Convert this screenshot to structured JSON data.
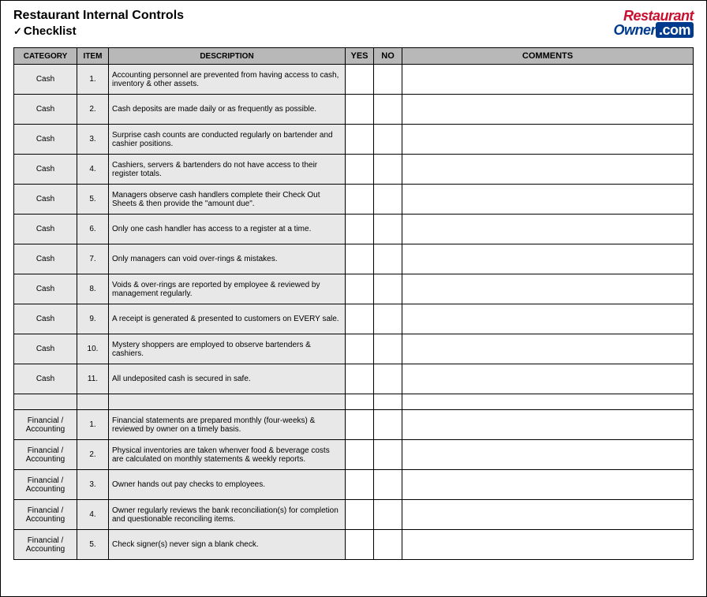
{
  "header": {
    "title": "Restaurant Internal Controls",
    "subtitle": "Checklist",
    "logo_top": "Restaurant",
    "logo_owner": "Owner",
    "logo_com": ".com"
  },
  "columns": {
    "category": "CATEGORY",
    "item": "ITEM",
    "description": "DESCRIPTION",
    "yes": "YES",
    "no": "NO",
    "comments": "COMMENTS"
  },
  "rows": [
    {
      "category": "Cash",
      "item": "1.",
      "description": "Accounting personnel are prevented from having access to cash, inventory & other assets."
    },
    {
      "category": "Cash",
      "item": "2.",
      "description": "Cash deposits are made daily or as frequently as possible."
    },
    {
      "category": "Cash",
      "item": "3.",
      "description": "Surprise cash counts are conducted regularly on bartender and cashier positions."
    },
    {
      "category": "Cash",
      "item": "4.",
      "description": "Cashiers, servers & bartenders do not have access to their register totals."
    },
    {
      "category": "Cash",
      "item": "5.",
      "description": "Managers observe cash handlers complete their Check Out Sheets & then provide the \"amount due\"."
    },
    {
      "category": "Cash",
      "item": "6.",
      "description": "Only one cash handler has access to a register at a time."
    },
    {
      "category": "Cash",
      "item": "7.",
      "description": "Only managers can void over-rings & mistakes."
    },
    {
      "category": "Cash",
      "item": "8.",
      "description": "Voids & over-rings are reported by employee & reviewed by management regularly."
    },
    {
      "category": "Cash",
      "item": "9.",
      "description": "A receipt is generated & presented to customers on EVERY sale."
    },
    {
      "category": "Cash",
      "item": "10.",
      "description": "Mystery shoppers are employed to observe bartenders & cashiers."
    },
    {
      "category": "Cash",
      "item": "11.",
      "description": "All undeposited cash is secured in safe."
    },
    {
      "spacer": true
    },
    {
      "category": "Financial / Accounting",
      "item": "1.",
      "description": "Financial statements are prepared monthly (four-weeks) & reviewed by owner on a timely basis."
    },
    {
      "category": "Financial / Accounting",
      "item": "2.",
      "description": "Physical inventories are taken whenver food & beverage costs are calculated on monthly statements & weekly reports."
    },
    {
      "category": "Financial / Accounting",
      "item": "3.",
      "description": "Owner hands out pay checks to employees."
    },
    {
      "category": "Financial / Accounting",
      "item": "4.",
      "description": "Owner regularly reviews the bank reconciliation(s) for completion and questionable reconciling items."
    },
    {
      "category": "Financial / Accounting",
      "item": "5.",
      "description": "Check signer(s) never sign a blank check."
    }
  ]
}
